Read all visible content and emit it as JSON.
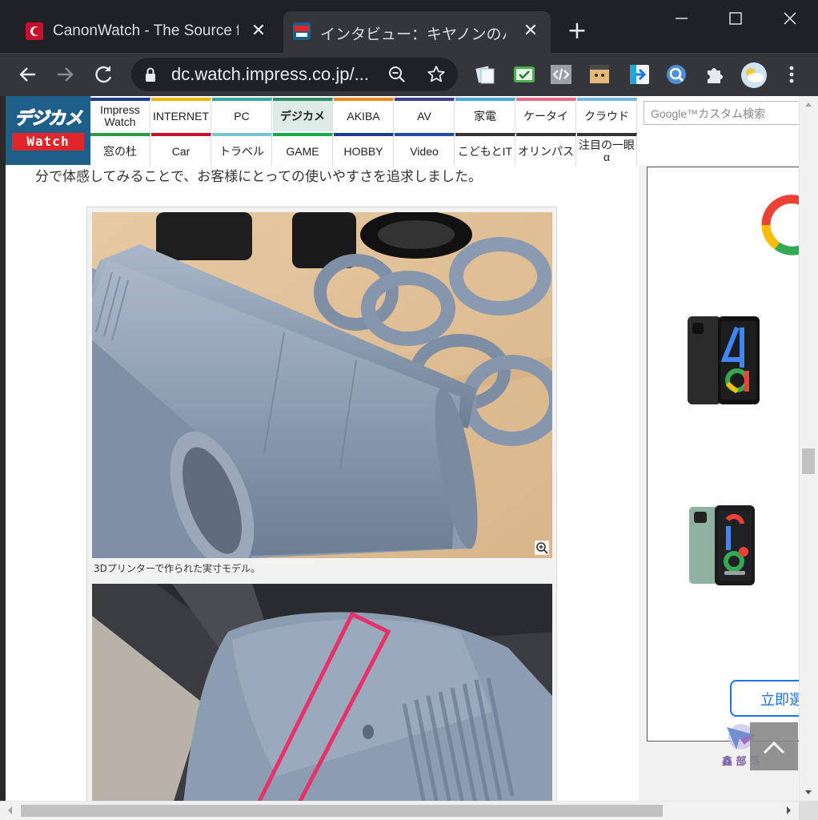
{
  "tabs": [
    {
      "title": "CanonWatch - The Source for Canon Rumors",
      "close": "✕"
    },
    {
      "title": "インタビュー：キヤノンのハンズオン",
      "close": "✕"
    }
  ],
  "new_tab": "+",
  "window": {
    "minimize": "─",
    "maximize": "☐",
    "close": "✕"
  },
  "address_bar": {
    "url": "dc.watch.impress.co.jp/..."
  },
  "site": {
    "logo_top": "デジカメ",
    "logo_bottom": "Watch",
    "search_placeholder": "Google™カスタム検索",
    "nav_row1": [
      {
        "label": "Impress Watch",
        "color": "#1d3d8f"
      },
      {
        "label": "INTERNET",
        "color": "#f0b400"
      },
      {
        "label": "PC",
        "color": "#3aa6a0"
      },
      {
        "label": "デジカメ",
        "color": "#2f8f6b"
      },
      {
        "label": "AKIBA",
        "color": "#e98a1a"
      },
      {
        "label": "AV",
        "color": "#3b3f8f"
      },
      {
        "label": "家電",
        "color": "#4aa8d8"
      },
      {
        "label": "ケータイ",
        "color": "#e86a8a"
      },
      {
        "label": "クラウド",
        "color": "#6fb8e0"
      }
    ],
    "nav_row2": [
      {
        "label": "窓の杜",
        "color": "#2e9a3b"
      },
      {
        "label": "Car",
        "color": "#c8102e"
      },
      {
        "label": "トラベル",
        "color": "#7ac6d0"
      },
      {
        "label": "GAME",
        "color": "#1aa84a"
      },
      {
        "label": "HOBBY",
        "color": "#1d3d8f"
      },
      {
        "label": "Video",
        "color": "#1d4fa0"
      },
      {
        "label": "こどもとIT",
        "color": "#333333"
      },
      {
        "label": "オリンパス",
        "color": "#333333"
      },
      {
        "label": "注目の一眼α",
        "color": "#333333"
      }
    ],
    "active_nav": "デジカメ"
  },
  "article": {
    "paragraph": "分で体感してみることで、お客様にとっての使いやすさを追求しました。",
    "caption": "3Dプリンターで作られた実寸モデル。"
  },
  "ad": {
    "cta": "立即選購"
  },
  "watermark": "鑫 部 落",
  "colors": {
    "chrome_dark": "#202124",
    "chrome_mid": "#35363a",
    "accent_red": "#e0262b",
    "ad_blue": "#1a73e8",
    "model_grey": "#8c9db2"
  }
}
